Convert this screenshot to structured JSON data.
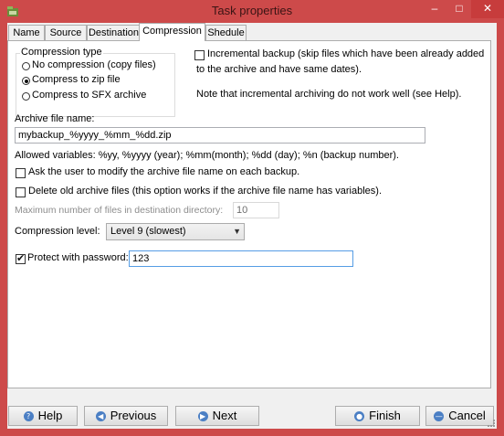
{
  "window": {
    "title": "Task properties",
    "controls": {
      "minimize": "–",
      "maximize": "□",
      "close": "✕"
    }
  },
  "tabs": [
    {
      "label": "Name"
    },
    {
      "label": "Source"
    },
    {
      "label": "Destination"
    },
    {
      "label": "Compression",
      "active": true
    },
    {
      "label": "Shedule"
    }
  ],
  "compression_type": {
    "title": "Compression type",
    "options": [
      {
        "label": "No compression (copy files)",
        "selected": false
      },
      {
        "label": "Compress to zip file",
        "selected": true
      },
      {
        "label": "Compress to SFX archive",
        "selected": false
      }
    ]
  },
  "incremental": {
    "checked": false,
    "label_line1": "Incremental backup (skip files which have been already added",
    "label_line2": "to the archive and have same dates).",
    "note": "Note that incremental archiving do not work well (see Help)."
  },
  "archive_name": {
    "label": "Archive file name:",
    "value": "mybackup_%yyyy_%mm_%dd.zip",
    "allowed_vars": "Allowed variables: %yy, %yyyy (year); %mm(month); %dd (day); %n (backup number)."
  },
  "ask_modify": {
    "checked": false,
    "label": "Ask the user to modify the archive file name on each backup."
  },
  "delete_old": {
    "checked": false,
    "label": "Delete old archive files (this option works if the archive file name has variables)."
  },
  "max_files": {
    "label": "Maximum number of files in destination directory:",
    "value": "10"
  },
  "compression_level": {
    "label": "Compression level:",
    "value": "Level 9 (slowest)"
  },
  "password": {
    "checked": true,
    "label": "Protect with password:",
    "value": "123"
  },
  "buttons": {
    "help": "Help",
    "previous": "Previous",
    "next": "Next",
    "finish": "Finish",
    "cancel": "Cancel"
  },
  "colors": {
    "window_frame": "#cd4a4a",
    "button_icon": "#4b7fc4",
    "focus_border": "#569de5"
  }
}
